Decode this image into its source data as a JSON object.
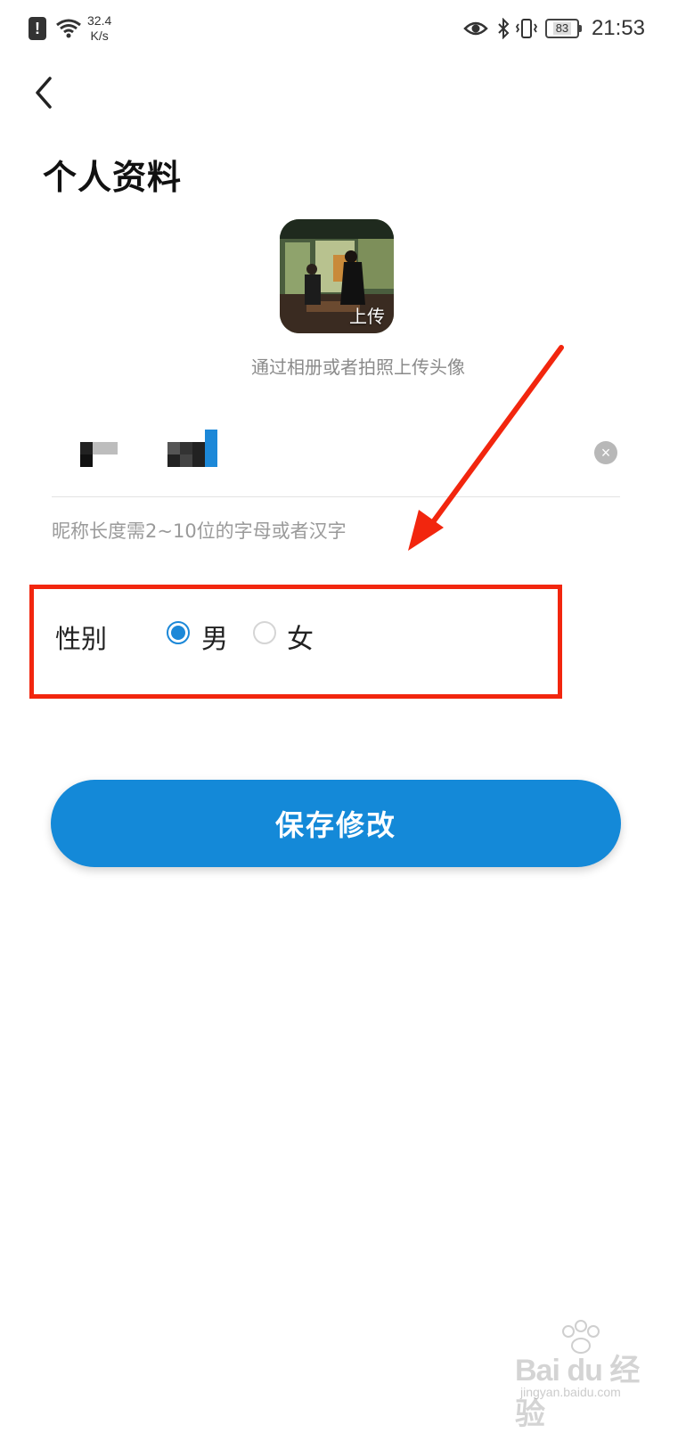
{
  "status_bar": {
    "alert_icon": "!",
    "net_speed_value": "32.4",
    "net_speed_unit": "K/s",
    "battery_level": "83",
    "time": "21:53"
  },
  "header": {
    "back_icon": "chevron-left-icon",
    "title": "个人资料"
  },
  "avatar": {
    "upload_label": "上传",
    "hint": "通过相册或者拍照上传头像"
  },
  "nickname": {
    "clear_icon": "×",
    "hint": "昵称长度需2~10位的字母或者汉字"
  },
  "gender": {
    "label": "性别",
    "options": [
      {
        "label": "男",
        "selected": true
      },
      {
        "label": "女",
        "selected": false
      }
    ]
  },
  "save_button": {
    "label": "保存修改"
  },
  "colors": {
    "accent": "#1489d8",
    "annotation": "#f2260e"
  },
  "watermark": {
    "brand": "Bai du 经验",
    "site": "jingyan.baidu.com"
  }
}
